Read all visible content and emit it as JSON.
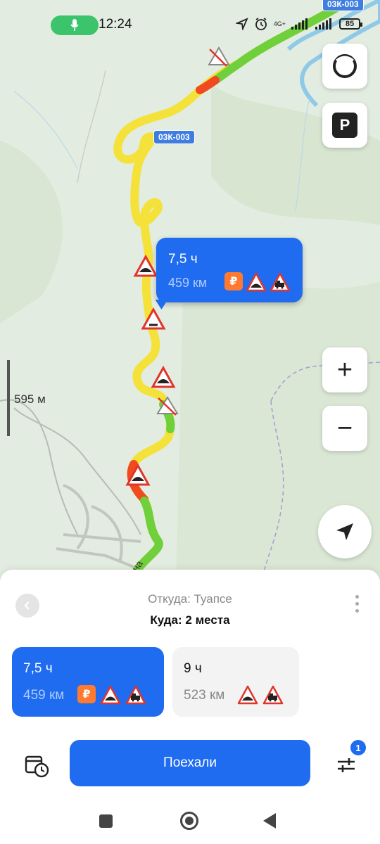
{
  "status_bar": {
    "time": "12:24",
    "network": "4G+",
    "battery": "85",
    "icons": [
      "mic-icon",
      "location-arrow-icon",
      "alarm-icon",
      "signal-icon",
      "battery-icon"
    ]
  },
  "map": {
    "road_label_top": "03К-003",
    "road_label": "03К-003",
    "scale_label": "595 м",
    "street_fragment": "на",
    "route_bubble": {
      "time": "7,5 ч",
      "distance": "459 км",
      "toll_symbol": "₽"
    },
    "buttons": {
      "profile_icon": "alice-ring-icon",
      "parking_label": "P",
      "zoom_in": "+",
      "zoom_out": "−",
      "locate_icon": "navigation-arrow-icon"
    },
    "route_colors": {
      "yellow": "#f7e53b",
      "green": "#6dcf3a",
      "red": "#f04a1f"
    }
  },
  "sheet": {
    "from": "Откуда: Туапсе",
    "to": "Куда: 2 места",
    "routes": [
      {
        "time": "7,5 ч",
        "distance": "459 км",
        "toll": "₽",
        "selected": true
      },
      {
        "time": "9 ч",
        "distance": "523 км",
        "selected": false
      }
    ],
    "go_label": "Поехали",
    "settings_badge": "1"
  },
  "colors": {
    "accent": "#1f6cf0",
    "toll": "#ff7a2f",
    "warning_red": "#e0352b"
  }
}
